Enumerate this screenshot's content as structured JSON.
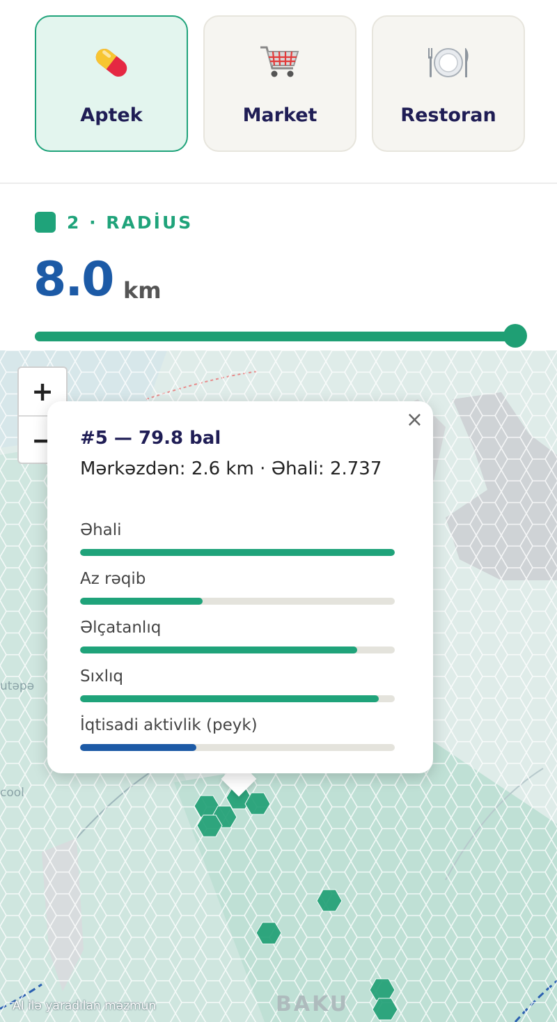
{
  "categories": [
    {
      "label": "Aptek",
      "icon": "pill-icon",
      "active": true
    },
    {
      "label": "Market",
      "icon": "shopping-cart-icon",
      "active": false
    },
    {
      "label": "Restoran",
      "icon": "plate-cutlery-icon",
      "active": false
    }
  ],
  "radius_section": {
    "title": "2 · RADİUS",
    "value": "8.0",
    "unit": "km",
    "slider_fraction": 1.0
  },
  "map": {
    "zoom_in_label": "+",
    "zoom_out_label": "−",
    "city_label": "BAKU",
    "side_label": "utəpə",
    "side_label_2": "cool",
    "watermark": "AI ilə yaradılan məzmun",
    "accent": "#1fa37a"
  },
  "popup": {
    "close_label": "×",
    "title": "#5 — 79.8 bal",
    "subtitle": "Mərkəzdən: 2.6 km · Əhali: 2.737",
    "metrics": [
      {
        "label": "Əhali",
        "fraction": 1.0,
        "color": "#1fa37a"
      },
      {
        "label": "Az rəqib",
        "fraction": 0.39,
        "color": "#1fa37a"
      },
      {
        "label": "Əlçatanlıq",
        "fraction": 0.88,
        "color": "#1fa37a"
      },
      {
        "label": "Sıxlıq",
        "fraction": 0.95,
        "color": "#1fa37a"
      },
      {
        "label": "İqtisadi aktivlik (peyk)",
        "fraction": 0.37,
        "color": "#1c5aa6"
      }
    ]
  }
}
